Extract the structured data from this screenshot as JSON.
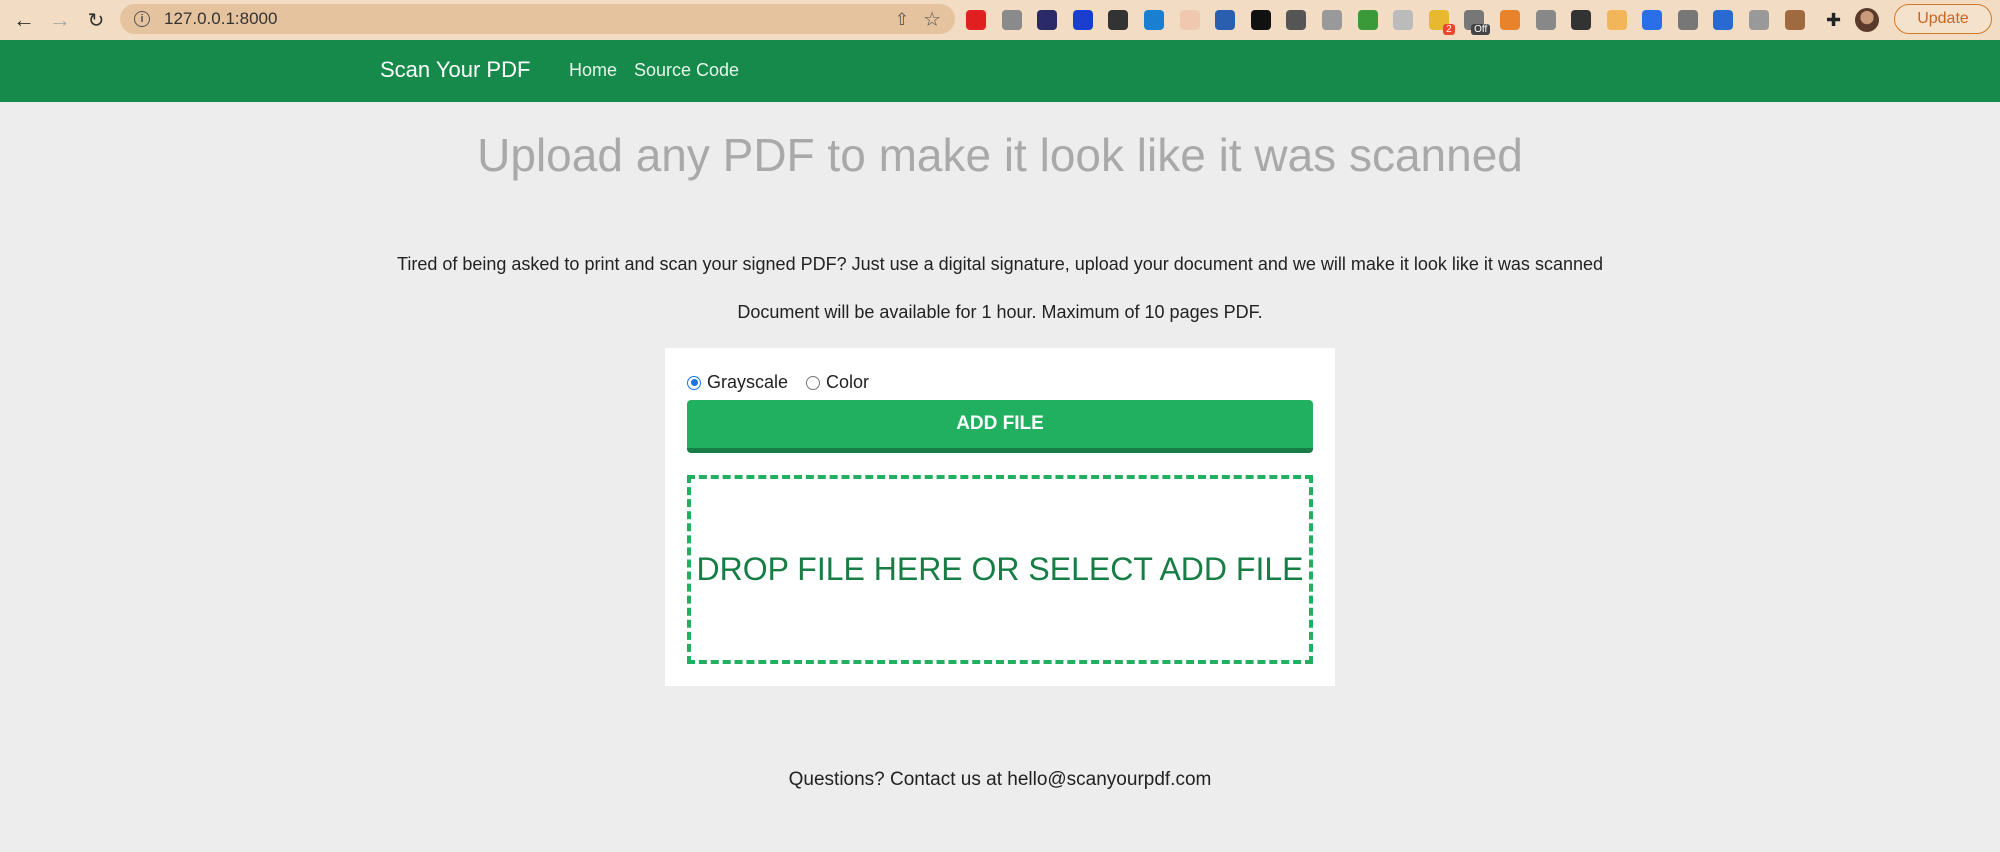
{
  "browser": {
    "url": "127.0.0.1:8000",
    "update_label": "Update",
    "extensions": [
      {
        "icon": "opera-icon",
        "color": "#e02020"
      },
      {
        "icon": "camera-icon",
        "color": "#8a8a8a"
      },
      {
        "icon": "block-icon",
        "color": "#2a2a6a"
      },
      {
        "icon": "circle-c-icon",
        "color": "#1a3fd0"
      },
      {
        "icon": "folder-icon",
        "color": "#333"
      },
      {
        "icon": "s-icon",
        "color": "#1a7fd0"
      },
      {
        "icon": "gear-flower-icon",
        "color": "#f0c8b0"
      },
      {
        "icon": "save-icon",
        "color": "#2a5fb0"
      },
      {
        "icon": "pip-icon",
        "color": "#111"
      },
      {
        "icon": "translate-icon",
        "color": "#555"
      },
      {
        "icon": "v-icon",
        "color": "#999"
      },
      {
        "icon": "plus-ghost-icon",
        "color": "#3a9a3a"
      },
      {
        "icon": "ghost-icon",
        "color": "#bbb"
      },
      {
        "icon": "bulb-icon",
        "color": "#e8b830",
        "badge": "2"
      },
      {
        "icon": "hat-icon",
        "color": "#777",
        "badge": "Off"
      },
      {
        "icon": "fox-icon",
        "color": "#e8832b"
      },
      {
        "icon": "cast-icon",
        "color": "#888"
      },
      {
        "icon": "dropper-icon",
        "color": "#333"
      },
      {
        "icon": "box-icon",
        "color": "#f2b65a"
      },
      {
        "icon": "pen-icon",
        "color": "#2b6fe8"
      },
      {
        "icon": "glasses-icon",
        "color": "#777"
      },
      {
        "icon": "s-square-icon",
        "color": "#2a6ad0"
      },
      {
        "icon": "crx-icon",
        "color": "#999"
      },
      {
        "icon": "cookie-icon",
        "color": "#a06a40"
      }
    ]
  },
  "site": {
    "brand": "Scan Your PDF",
    "nav": [
      "Home",
      "Source Code"
    ]
  },
  "main": {
    "headline": "Upload any PDF to make it look like it was scanned",
    "intro": "Tired of being asked to print and scan your signed PDF? Just use a digital signature, upload your document and we will make it look like it was scanned",
    "notice": "Document will be available for 1 hour. Maximum of 10 pages PDF.",
    "options": [
      {
        "label": "Grayscale",
        "checked": true
      },
      {
        "label": "Color",
        "checked": false
      }
    ],
    "add_file_label": "ADD FILE",
    "dropzone_label": "DROP FILE HERE OR SELECT ADD FILE"
  },
  "footer": {
    "contact": "Questions? Contact us at hello@scanyourpdf.com"
  },
  "colors": {
    "navbar": "#168a4a",
    "button": "#21b060",
    "dropzone_text": "#167d44",
    "headline": "#a9a9a9"
  }
}
